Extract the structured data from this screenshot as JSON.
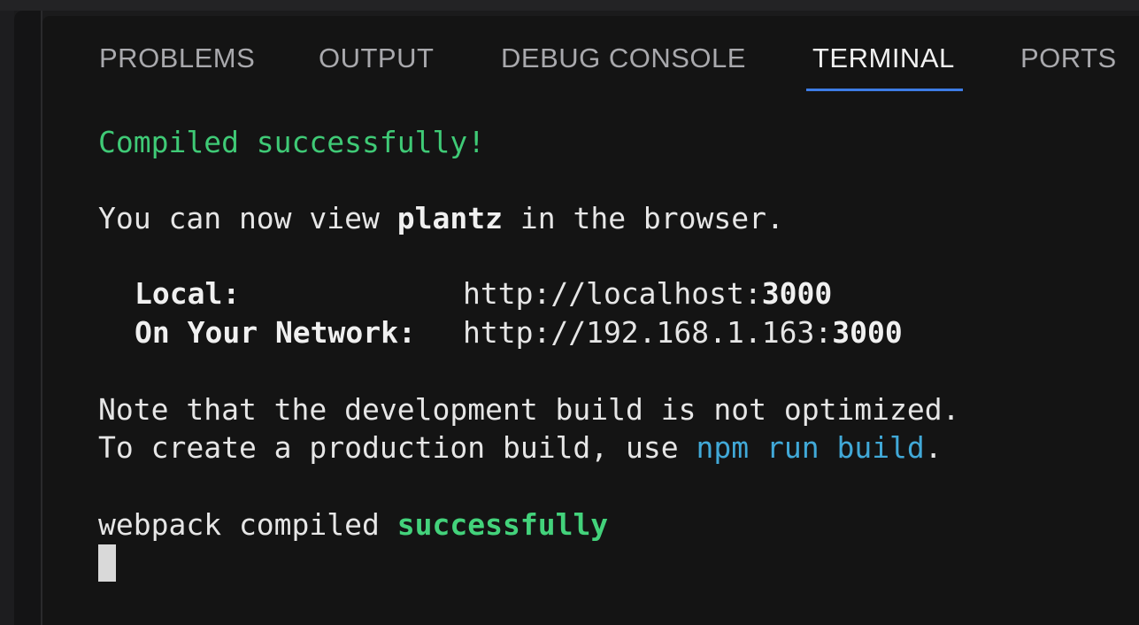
{
  "tabs": [
    {
      "label": "PROBLEMS",
      "active": false
    },
    {
      "label": "OUTPUT",
      "active": false
    },
    {
      "label": "DEBUG CONSOLE",
      "active": false
    },
    {
      "label": "TERMINAL",
      "active": true
    },
    {
      "label": "PORTS",
      "active": false
    }
  ],
  "colors": {
    "accent": "#3d7ce6",
    "success": "#3fca76",
    "link": "#41a9d8",
    "background": "#141414"
  },
  "terminal": {
    "compiled": "Compiled successfully!",
    "view_prefix": "You can now view ",
    "app_name": "plantz",
    "view_suffix": " in the browser.",
    "local_label": "Local:",
    "local_url_prefix": "http://localhost:",
    "local_port": "3000",
    "network_label": "On Your Network:",
    "network_url_prefix": "http://192.168.1.163:",
    "network_port": "3000",
    "note_line": "Note that the development build is not optimized.",
    "prod_prefix": "To create a production build, use ",
    "prod_command": "npm run build",
    "prod_suffix": ".",
    "webpack_prefix": "webpack compiled ",
    "webpack_status": "successfully"
  }
}
